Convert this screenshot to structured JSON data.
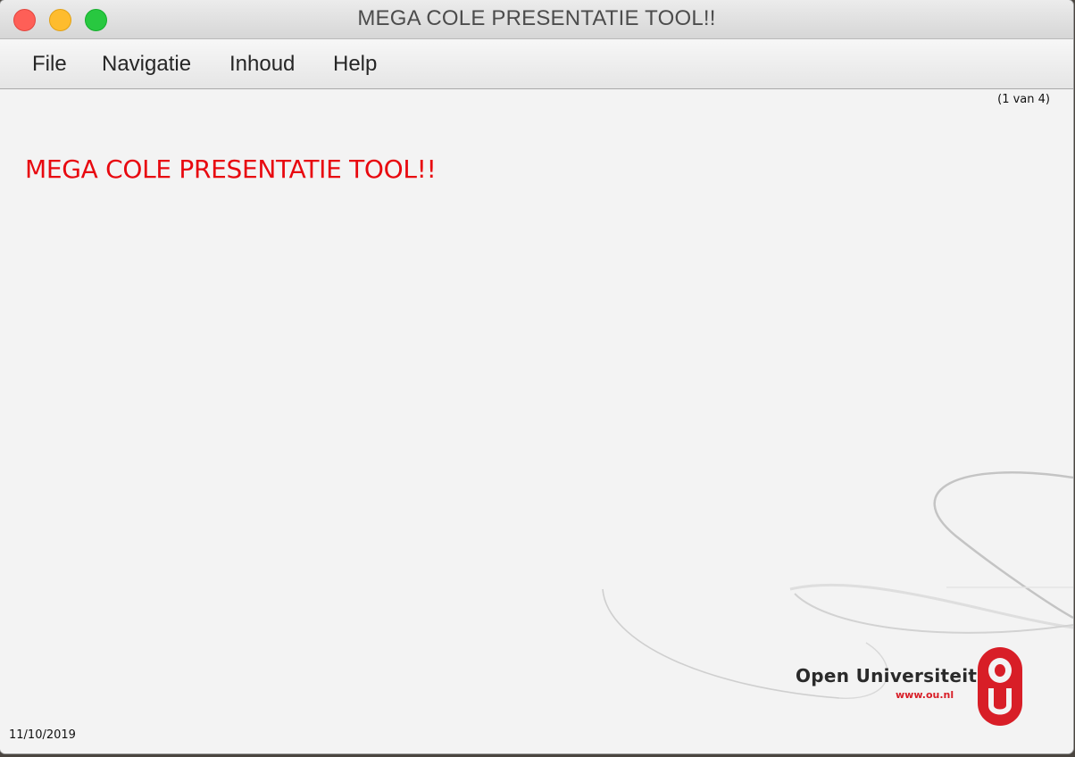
{
  "window": {
    "title": "MEGA COLE PRESENTATIE TOOL!!"
  },
  "menubar": {
    "items": [
      {
        "label": "File"
      },
      {
        "label": "Navigatie"
      },
      {
        "label": "Inhoud"
      },
      {
        "label": "Help"
      }
    ]
  },
  "slide": {
    "counter": "(1 van 4)",
    "title": "MEGA COLE PRESENTATIE TOOL!!",
    "title_color": "#e8080f",
    "date": "11/10/2019"
  },
  "logo": {
    "name": "Open Universiteit",
    "url": "www.ou.nl",
    "brand_color": "#d81e27",
    "mark_icon": "ou-logo-icon"
  }
}
